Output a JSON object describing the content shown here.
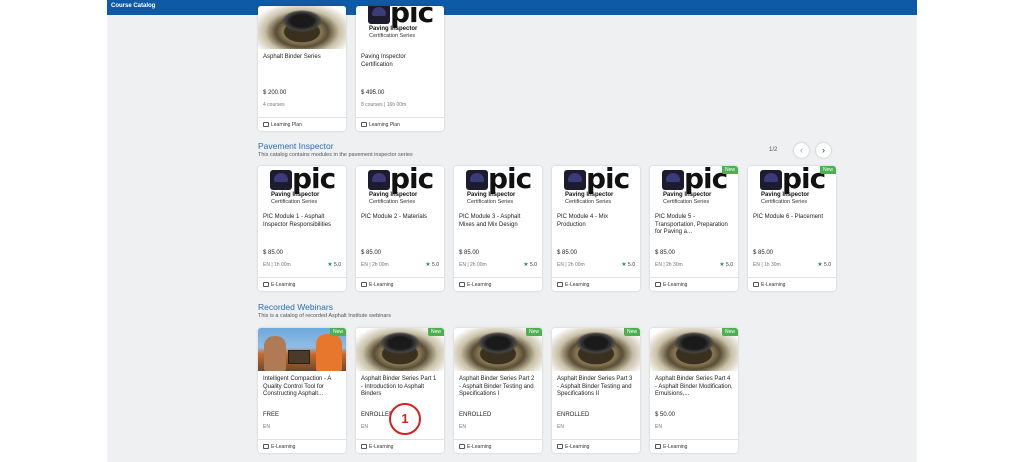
{
  "window": {
    "title": "Course Catalog"
  },
  "top_cards": [
    {
      "title": "Asphalt Binder Series",
      "price": "$ 200.00",
      "meta": "4 courses",
      "footer": "Learning Plan",
      "thumb": "binder"
    },
    {
      "title": "Paving Inspector Certification",
      "price": "$ 495.00",
      "meta": "8 courses  |  16h 00m",
      "footer": "Learning Plan",
      "thumb": "pic"
    }
  ],
  "pic_logo": {
    "text": "pic",
    "line1": "Paving Inspector",
    "line2": "Certification Series"
  },
  "pavement": {
    "title": "Pavement Inspector",
    "description": "This catalog contains modules in the pavement inspector series",
    "pager": "1/2",
    "prev_icon": "chevron-left-icon",
    "next_icon": "chevron-right-icon",
    "cards": [
      {
        "title": "PIC Module 1 - Asphalt Inspector Responsibilities",
        "price": "$ 85.00",
        "meta": "EN  |  1h 00m",
        "rating": "5.0",
        "footer": "E-Learning",
        "badge": ""
      },
      {
        "title": "PIC Module 2 - Materials",
        "price": "$ 85.00",
        "meta": "EN  |  2h 00m",
        "rating": "5.0",
        "footer": "E-Learning",
        "badge": ""
      },
      {
        "title": "PIC Module 3 - Asphalt Mixes and Mix Design",
        "price": "$ 85.00",
        "meta": "EN  |  2h 00m",
        "rating": "5.0",
        "footer": "E-Learning",
        "badge": ""
      },
      {
        "title": "PIC Module 4 - Mix Production",
        "price": "$ 85.00",
        "meta": "EN  |  2h 00m",
        "rating": "5.0",
        "footer": "E-Learning",
        "badge": ""
      },
      {
        "title": "PIC Module 5 - Transportation, Preparation for Paving a...",
        "price": "$ 85.00",
        "meta": "EN  |  2h 30m",
        "rating": "5.0",
        "footer": "E-Learning",
        "badge": "New"
      },
      {
        "title": "PIC Module 6 - Placement",
        "price": "$ 85.00",
        "meta": "EN  |  1h 30m",
        "rating": "5.0",
        "footer": "E-Learning",
        "badge": "New"
      }
    ]
  },
  "webinars": {
    "title": "Recorded Webinars",
    "description": "This is a catalog of recorded Asphalt Institute webinars",
    "cards": [
      {
        "title": "Intelligent Compaction - A Quality Control Tool for Constructing Asphalt...",
        "price": "FREE",
        "meta": "EN",
        "footer": "E-Learning",
        "badge": "New",
        "thumb": "photo"
      },
      {
        "title": "Asphalt Binder Series Part 1 - Introduction to Asphalt Binders",
        "price": "ENROLLED",
        "meta": "EN",
        "footer": "E-Learning",
        "badge": "New",
        "thumb": "binder"
      },
      {
        "title": "Asphalt Binder Series Part 2 - Asphalt Binder Testing and Specifications I",
        "price": "ENROLLED",
        "meta": "EN",
        "footer": "E-Learning",
        "badge": "New",
        "thumb": "binder"
      },
      {
        "title": "Asphalt Binder Series Part 3 - Asphalt Binder Testing and Specifications II",
        "price": "ENROLLED",
        "meta": "EN",
        "footer": "E-Learning",
        "badge": "New",
        "thumb": "binder"
      },
      {
        "title": "Asphalt Binder Series Part 4 - Asphalt Binder Modification, Emulsions,...",
        "price": "$ 50.00",
        "meta": "EN",
        "footer": "E-Learning",
        "badge": "New",
        "thumb": "binder"
      }
    ]
  },
  "annotation": {
    "label": "1",
    "color": "#d62020"
  },
  "colors": {
    "accent": "#0e5aa7",
    "section_title": "#2a6db0",
    "badge": "#4caf50",
    "star": "#2e8b57"
  }
}
